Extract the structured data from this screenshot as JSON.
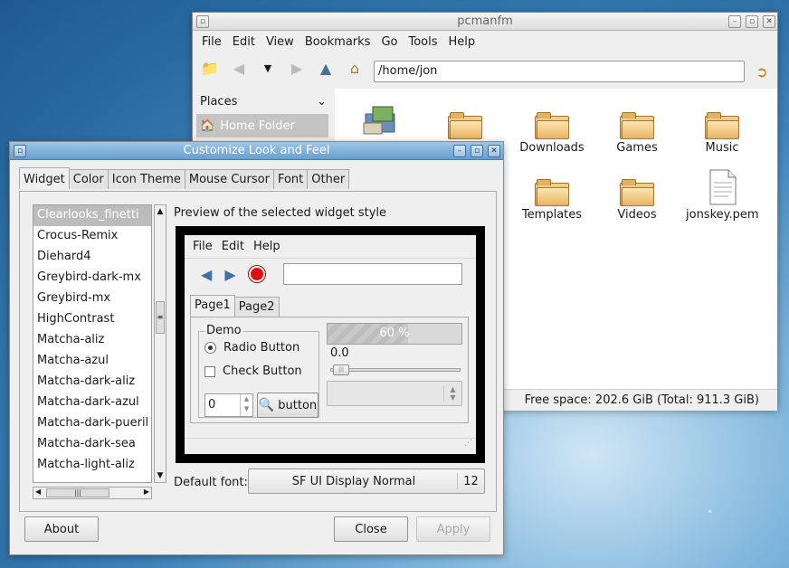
{
  "pcmanfm": {
    "title": "pcmanfm",
    "menu": [
      "File",
      "Edit",
      "View",
      "Bookmarks",
      "Go",
      "Tools",
      "Help"
    ],
    "path": "/home/jon",
    "places_label": "Places",
    "home_folder": "Home Folder",
    "files": [
      {
        "name": "",
        "icon": "desktop-icon"
      },
      {
        "name": "",
        "icon": "folder-icon"
      },
      {
        "name": "Downloads",
        "icon": "folder-icon"
      },
      {
        "name": "Games",
        "icon": "folder-icon"
      },
      {
        "name": "Music",
        "icon": "folder-icon"
      },
      {
        "name": "Templates",
        "icon": "folder-icon"
      },
      {
        "name": "Videos",
        "icon": "folder-icon"
      },
      {
        "name": "jonskey.pem",
        "icon": "document-icon"
      }
    ],
    "status": "Free space: 202.6 GiB (Total: 911.3 GiB)"
  },
  "dialog": {
    "title": "Customize Look and Feel",
    "tabs": [
      "Widget",
      "Color",
      "Icon Theme",
      "Mouse Cursor",
      "Font",
      "Other"
    ],
    "themes": [
      "Clearlooks_finetti",
      "Crocus-Remix",
      "Diehard4",
      "Greybird-dark-mx",
      "Greybird-mx",
      "HighContrast",
      "Matcha-aliz",
      "Matcha-azul",
      "Matcha-dark-aliz",
      "Matcha-dark-azul",
      "Matcha-dark-pueril",
      "Matcha-dark-sea",
      "Matcha-light-aliz"
    ],
    "preview_label": "Preview of the selected widget style",
    "preview": {
      "menu": [
        "File",
        "Edit",
        "Help"
      ],
      "tabs": [
        "Page1",
        "Page2"
      ],
      "demo_legend": "Demo",
      "radio_label": "Radio Button",
      "check_label": "Check Button",
      "spin_value": "0",
      "button_label": "button",
      "progress_text": "60 %",
      "progress_fraction": 0.6,
      "scale_value": "0.0"
    },
    "default_font_label": "Default font:",
    "font_name": "SF UI Display Normal",
    "font_size": "12",
    "about_label": "About",
    "close_label": "Close",
    "apply_label": "Apply"
  }
}
